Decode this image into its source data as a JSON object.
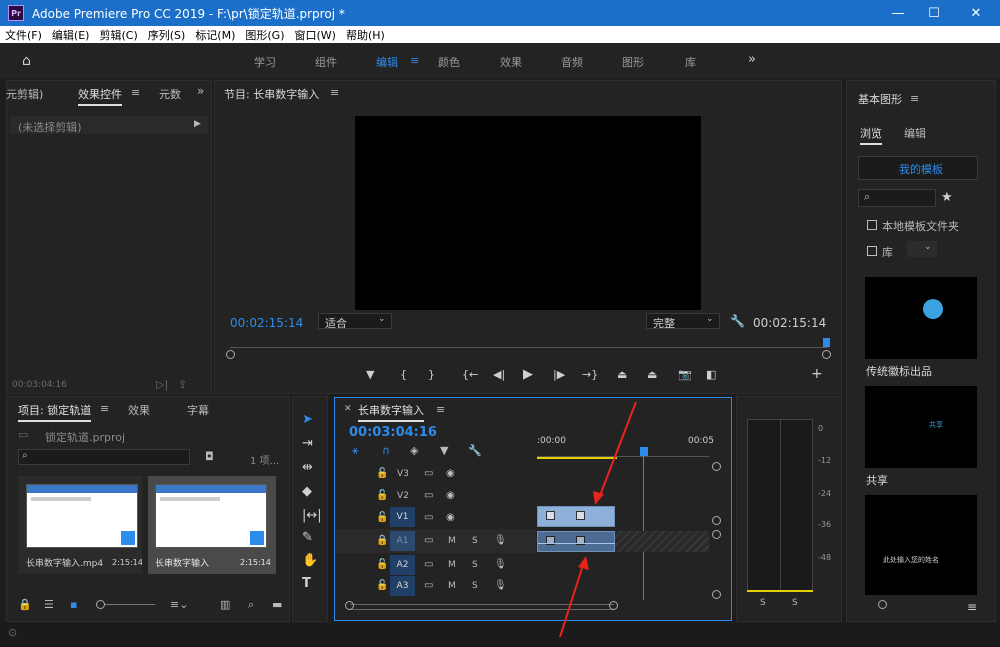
{
  "window": {
    "title": "Adobe Premiere Pro CC 2019 - F:\\pr\\锁定轨道.prproj *",
    "app_icon": "Pr"
  },
  "menu": [
    "文件(F)",
    "编辑(E)",
    "剪辑(C)",
    "序列(S)",
    "标记(M)",
    "图形(G)",
    "窗口(W)",
    "帮助(H)"
  ],
  "workspaces": [
    "学习",
    "组件",
    "编辑",
    "颜色",
    "效果",
    "音频",
    "图形",
    "库"
  ],
  "effect_controls": {
    "tabs": [
      "元剪辑)",
      "效果控件",
      "元数"
    ],
    "no_clip": "(未选择剪辑)",
    "timecode": "00:03:04:16"
  },
  "program": {
    "title": "节目: 长串数字输入",
    "timecode_left": "00:02:15:14",
    "fit": "适合",
    "quality": "完整",
    "timecode_right": "00:02:15:14"
  },
  "project": {
    "tabs": [
      "项目: 锁定轨道",
      "效果",
      "字幕"
    ],
    "file": "锁定轨道.prproj",
    "item_count": "1 项...",
    "items": [
      {
        "name": "长串数字输入.mp4",
        "duration": "2:15:14"
      },
      {
        "name": "长串数字输入",
        "duration": "2:15:14"
      }
    ]
  },
  "timeline": {
    "title": "长串数字输入",
    "timecode": "00:03:04:16",
    "ruler": [
      ":00:00",
      "00:05"
    ],
    "tracks": [
      {
        "id": "V3",
        "type": "video"
      },
      {
        "id": "V2",
        "type": "video"
      },
      {
        "id": "V1",
        "type": "video"
      },
      {
        "id": "A1",
        "type": "audio"
      },
      {
        "id": "A2",
        "type": "audio"
      },
      {
        "id": "A3",
        "type": "audio"
      }
    ],
    "m_label": "M",
    "s_label": "S"
  },
  "meter": {
    "scale": [
      "0",
      "-12",
      "-24",
      "-36",
      "-48"
    ],
    "solo": [
      "S",
      "S"
    ]
  },
  "essential_graphics": {
    "title": "基本图形",
    "tabs": [
      "浏览",
      "编辑"
    ],
    "my_templates": "我的模板",
    "local_folder": "本地模板文件夹",
    "library": "库",
    "templates": [
      {
        "name": "传统徽标出品",
        "overlay": ""
      },
      {
        "name": "共享",
        "overlay": "共享"
      },
      {
        "name": "",
        "overlay": "此处输入您的姓名"
      }
    ]
  },
  "colors": {
    "accent": "#2d8ceb",
    "titlebar": "#1b6fc9",
    "clip": "#8fb0d8"
  }
}
